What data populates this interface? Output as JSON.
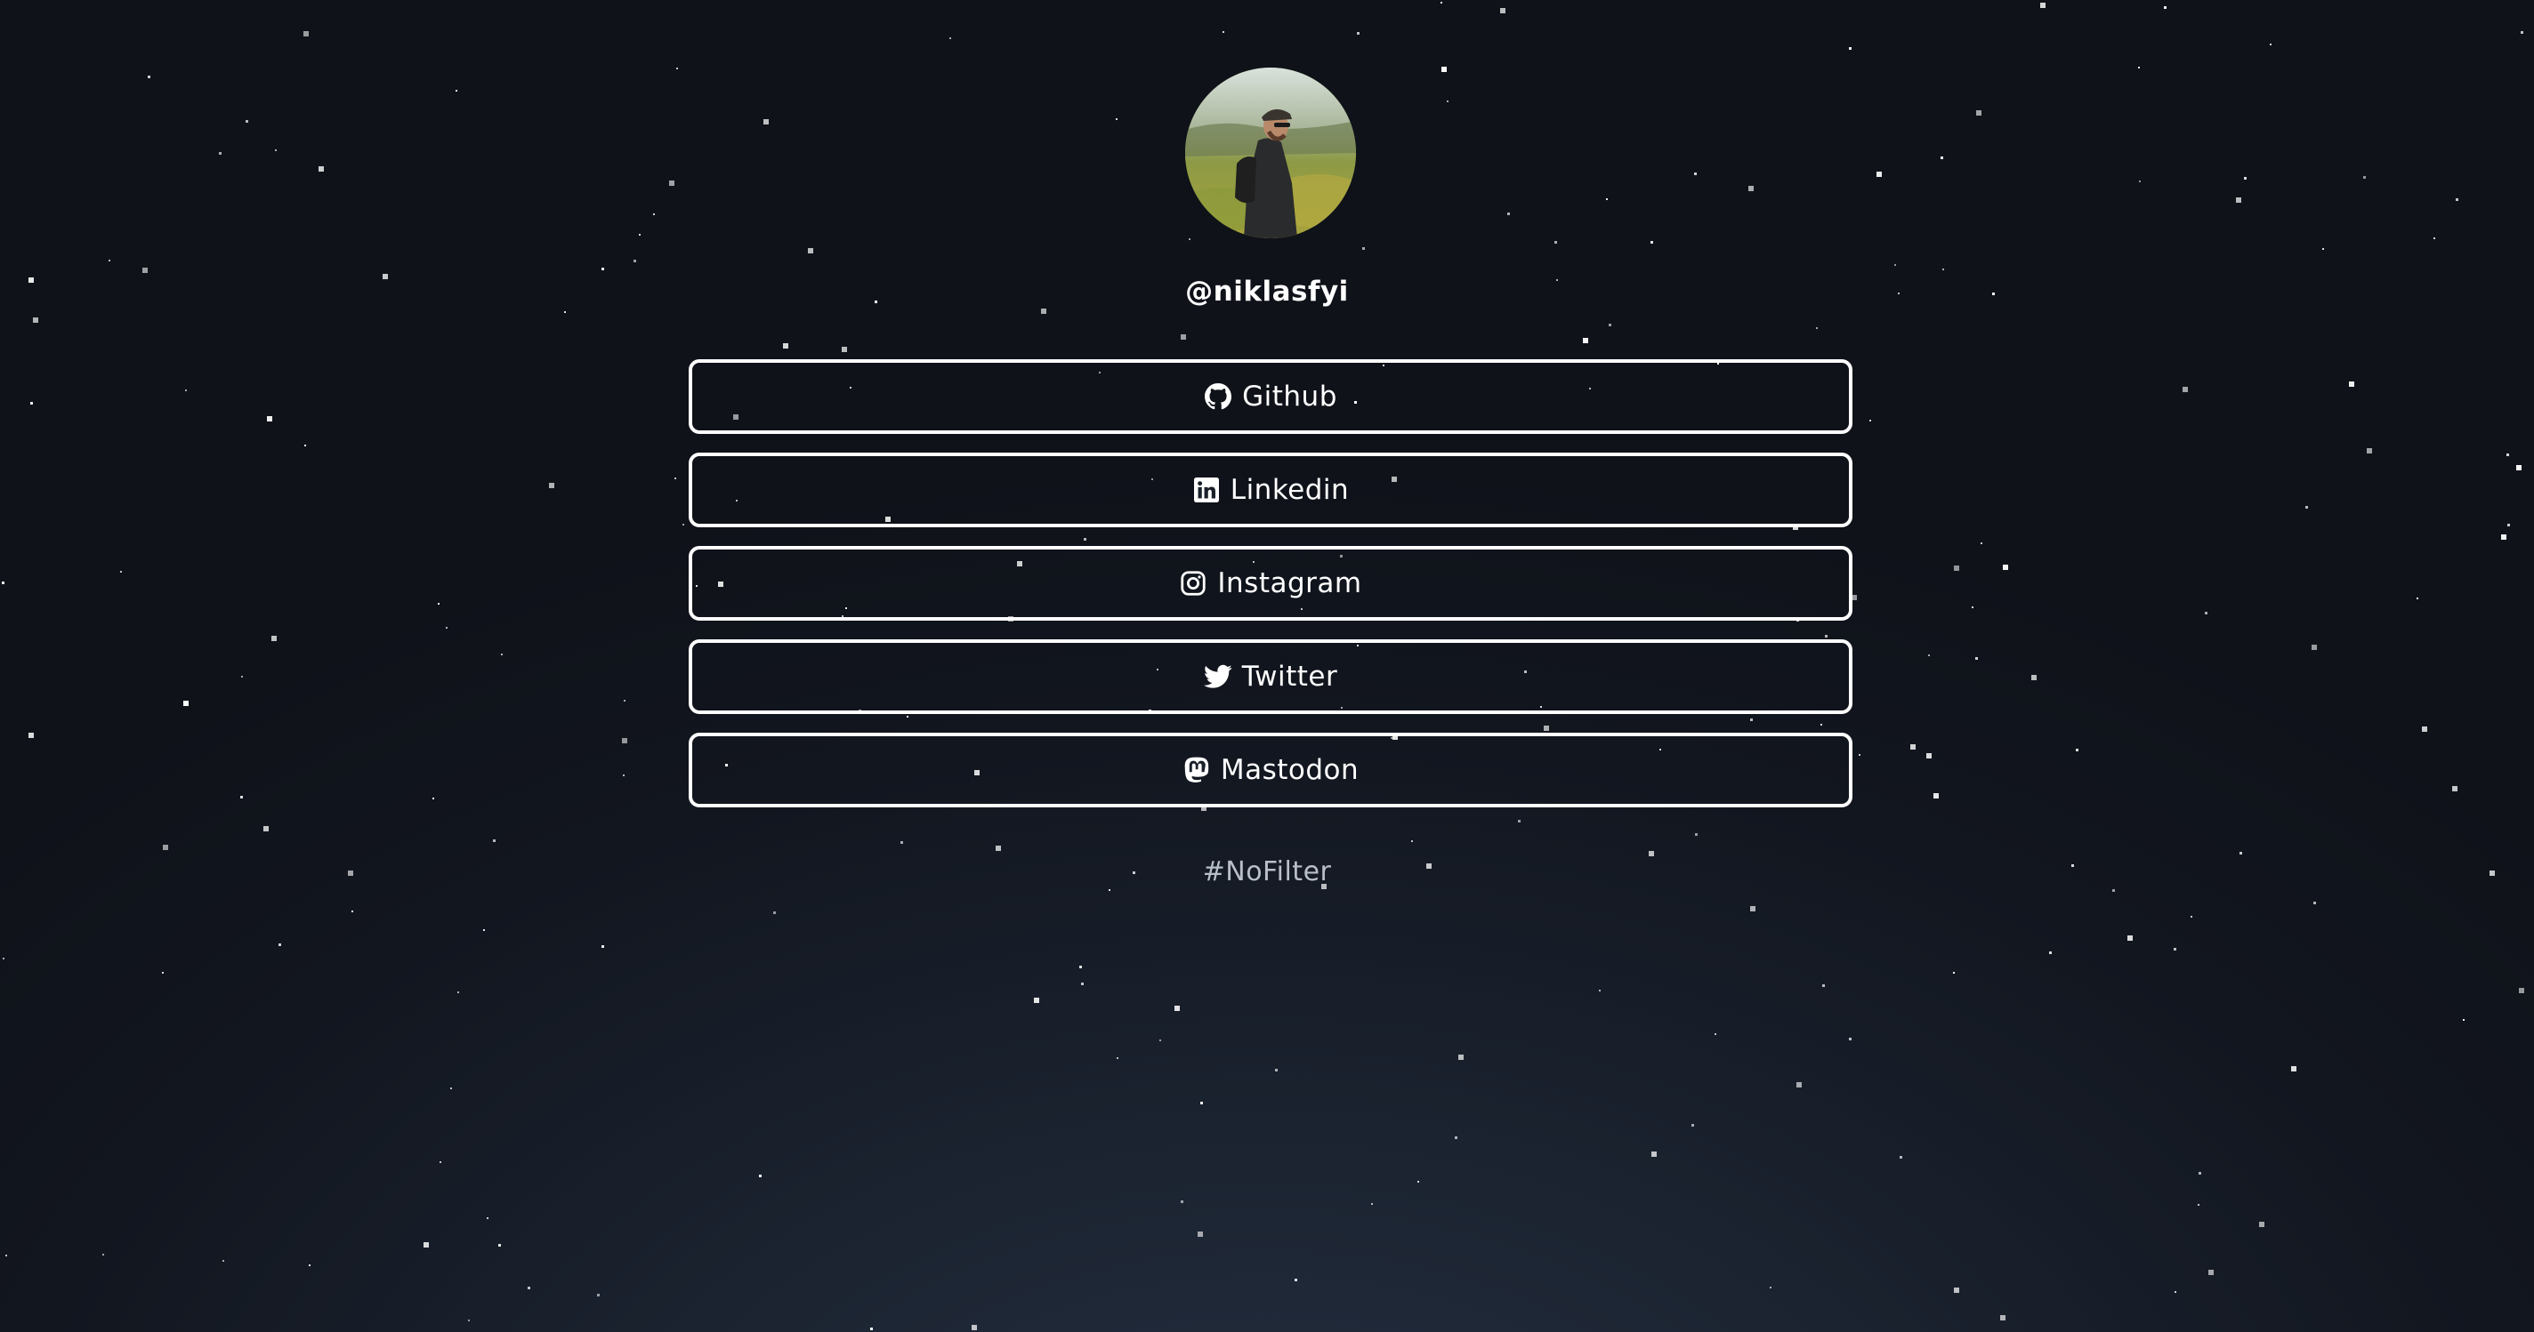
{
  "profile": {
    "handle": "@niklasfyi",
    "avatar_alt": "avatar"
  },
  "links": [
    {
      "label": "Github",
      "icon": "github-icon"
    },
    {
      "label": "Linkedin",
      "icon": "linkedin-icon"
    },
    {
      "label": "Instagram",
      "icon": "instagram-icon"
    },
    {
      "label": "Twitter",
      "icon": "twitter-icon"
    },
    {
      "label": "Mastodon",
      "icon": "mastodon-icon"
    }
  ],
  "footer": {
    "tagline": "#NoFilter"
  },
  "colors": {
    "background_top": "#0f1219",
    "background_bottom": "#253042",
    "button_border": "#ffffff",
    "text": "#ffffff",
    "tagline": "#b9bfc8"
  }
}
